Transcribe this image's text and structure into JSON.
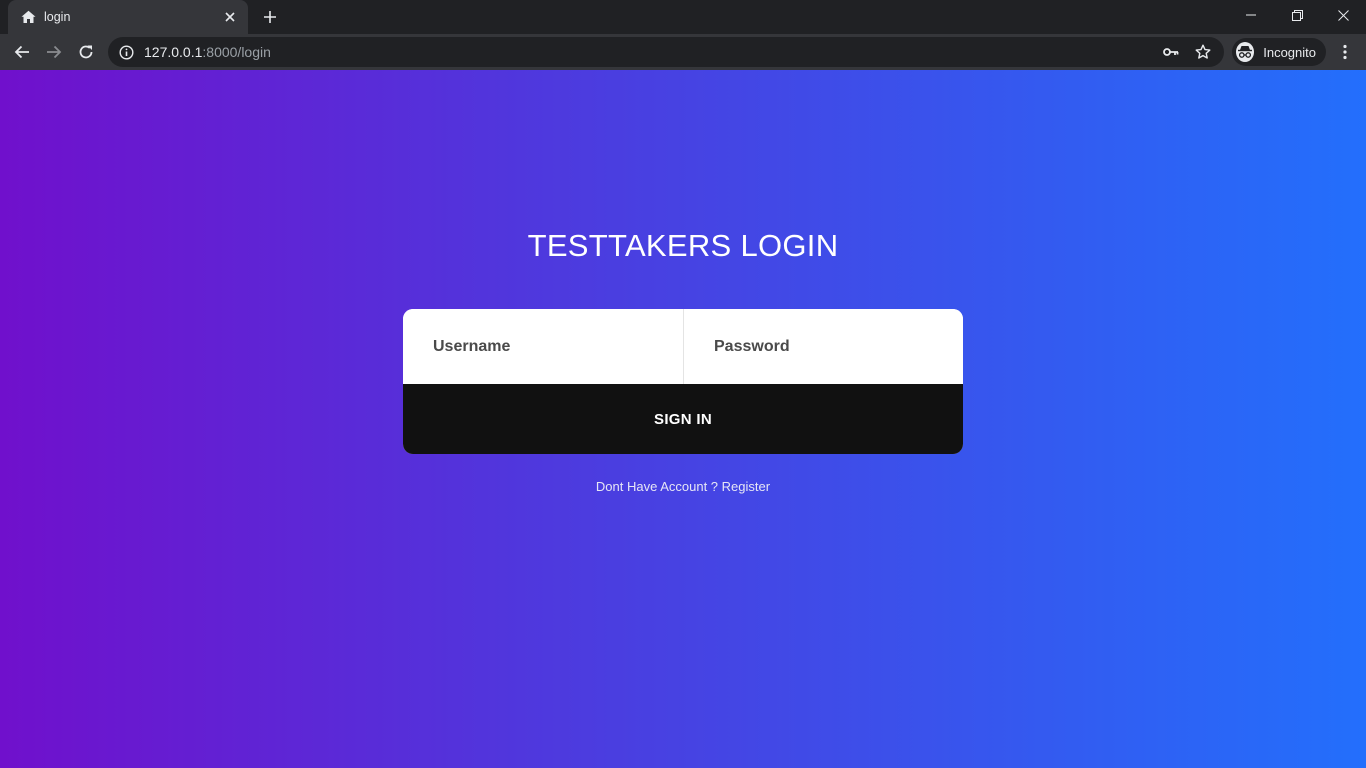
{
  "browser": {
    "tab": {
      "title": "login"
    },
    "address": {
      "host": "127.0.0.1",
      "rest": ":8000/login"
    },
    "profile": {
      "label": "Incognito"
    }
  },
  "page": {
    "title": "TESTTAKERS LOGIN",
    "username": {
      "placeholder": "Username",
      "value": ""
    },
    "password": {
      "placeholder": "Password",
      "value": ""
    },
    "signin_label": "SIGN IN",
    "register_prompt": "Dont Have Account ?",
    "register_link": "Register"
  },
  "colors": {
    "gradient_start": "#7010cc",
    "gradient_end": "#236ffc",
    "button_bg": "#111111"
  }
}
